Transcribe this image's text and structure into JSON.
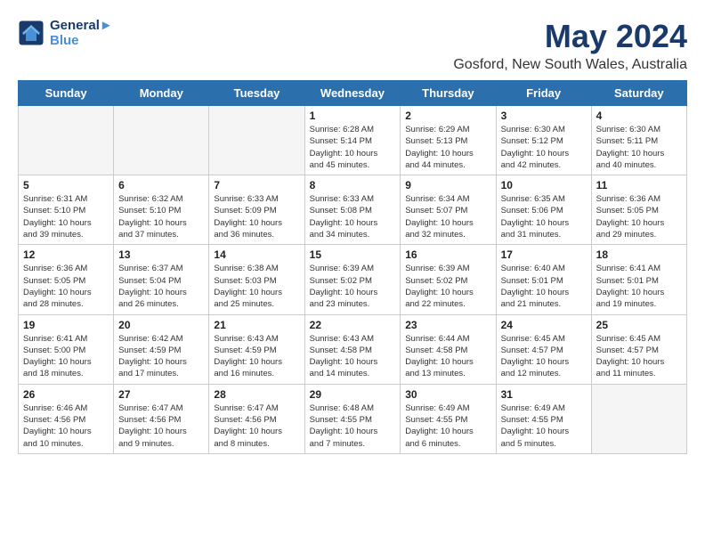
{
  "logo": {
    "line1": "General",
    "line2": "Blue"
  },
  "title": "May 2024",
  "subtitle": "Gosford, New South Wales, Australia",
  "days_of_week": [
    "Sunday",
    "Monday",
    "Tuesday",
    "Wednesday",
    "Thursday",
    "Friday",
    "Saturday"
  ],
  "weeks": [
    [
      {
        "day": "",
        "info": ""
      },
      {
        "day": "",
        "info": ""
      },
      {
        "day": "",
        "info": ""
      },
      {
        "day": "1",
        "info": "Sunrise: 6:28 AM\nSunset: 5:14 PM\nDaylight: 10 hours\nand 45 minutes."
      },
      {
        "day": "2",
        "info": "Sunrise: 6:29 AM\nSunset: 5:13 PM\nDaylight: 10 hours\nand 44 minutes."
      },
      {
        "day": "3",
        "info": "Sunrise: 6:30 AM\nSunset: 5:12 PM\nDaylight: 10 hours\nand 42 minutes."
      },
      {
        "day": "4",
        "info": "Sunrise: 6:30 AM\nSunset: 5:11 PM\nDaylight: 10 hours\nand 40 minutes."
      }
    ],
    [
      {
        "day": "5",
        "info": "Sunrise: 6:31 AM\nSunset: 5:10 PM\nDaylight: 10 hours\nand 39 minutes."
      },
      {
        "day": "6",
        "info": "Sunrise: 6:32 AM\nSunset: 5:10 PM\nDaylight: 10 hours\nand 37 minutes."
      },
      {
        "day": "7",
        "info": "Sunrise: 6:33 AM\nSunset: 5:09 PM\nDaylight: 10 hours\nand 36 minutes."
      },
      {
        "day": "8",
        "info": "Sunrise: 6:33 AM\nSunset: 5:08 PM\nDaylight: 10 hours\nand 34 minutes."
      },
      {
        "day": "9",
        "info": "Sunrise: 6:34 AM\nSunset: 5:07 PM\nDaylight: 10 hours\nand 32 minutes."
      },
      {
        "day": "10",
        "info": "Sunrise: 6:35 AM\nSunset: 5:06 PM\nDaylight: 10 hours\nand 31 minutes."
      },
      {
        "day": "11",
        "info": "Sunrise: 6:36 AM\nSunset: 5:05 PM\nDaylight: 10 hours\nand 29 minutes."
      }
    ],
    [
      {
        "day": "12",
        "info": "Sunrise: 6:36 AM\nSunset: 5:05 PM\nDaylight: 10 hours\nand 28 minutes."
      },
      {
        "day": "13",
        "info": "Sunrise: 6:37 AM\nSunset: 5:04 PM\nDaylight: 10 hours\nand 26 minutes."
      },
      {
        "day": "14",
        "info": "Sunrise: 6:38 AM\nSunset: 5:03 PM\nDaylight: 10 hours\nand 25 minutes."
      },
      {
        "day": "15",
        "info": "Sunrise: 6:39 AM\nSunset: 5:02 PM\nDaylight: 10 hours\nand 23 minutes."
      },
      {
        "day": "16",
        "info": "Sunrise: 6:39 AM\nSunset: 5:02 PM\nDaylight: 10 hours\nand 22 minutes."
      },
      {
        "day": "17",
        "info": "Sunrise: 6:40 AM\nSunset: 5:01 PM\nDaylight: 10 hours\nand 21 minutes."
      },
      {
        "day": "18",
        "info": "Sunrise: 6:41 AM\nSunset: 5:01 PM\nDaylight: 10 hours\nand 19 minutes."
      }
    ],
    [
      {
        "day": "19",
        "info": "Sunrise: 6:41 AM\nSunset: 5:00 PM\nDaylight: 10 hours\nand 18 minutes."
      },
      {
        "day": "20",
        "info": "Sunrise: 6:42 AM\nSunset: 4:59 PM\nDaylight: 10 hours\nand 17 minutes."
      },
      {
        "day": "21",
        "info": "Sunrise: 6:43 AM\nSunset: 4:59 PM\nDaylight: 10 hours\nand 16 minutes."
      },
      {
        "day": "22",
        "info": "Sunrise: 6:43 AM\nSunset: 4:58 PM\nDaylight: 10 hours\nand 14 minutes."
      },
      {
        "day": "23",
        "info": "Sunrise: 6:44 AM\nSunset: 4:58 PM\nDaylight: 10 hours\nand 13 minutes."
      },
      {
        "day": "24",
        "info": "Sunrise: 6:45 AM\nSunset: 4:57 PM\nDaylight: 10 hours\nand 12 minutes."
      },
      {
        "day": "25",
        "info": "Sunrise: 6:45 AM\nSunset: 4:57 PM\nDaylight: 10 hours\nand 11 minutes."
      }
    ],
    [
      {
        "day": "26",
        "info": "Sunrise: 6:46 AM\nSunset: 4:56 PM\nDaylight: 10 hours\nand 10 minutes."
      },
      {
        "day": "27",
        "info": "Sunrise: 6:47 AM\nSunset: 4:56 PM\nDaylight: 10 hours\nand 9 minutes."
      },
      {
        "day": "28",
        "info": "Sunrise: 6:47 AM\nSunset: 4:56 PM\nDaylight: 10 hours\nand 8 minutes."
      },
      {
        "day": "29",
        "info": "Sunrise: 6:48 AM\nSunset: 4:55 PM\nDaylight: 10 hours\nand 7 minutes."
      },
      {
        "day": "30",
        "info": "Sunrise: 6:49 AM\nSunset: 4:55 PM\nDaylight: 10 hours\nand 6 minutes."
      },
      {
        "day": "31",
        "info": "Sunrise: 6:49 AM\nSunset: 4:55 PM\nDaylight: 10 hours\nand 5 minutes."
      },
      {
        "day": "",
        "info": ""
      }
    ]
  ]
}
